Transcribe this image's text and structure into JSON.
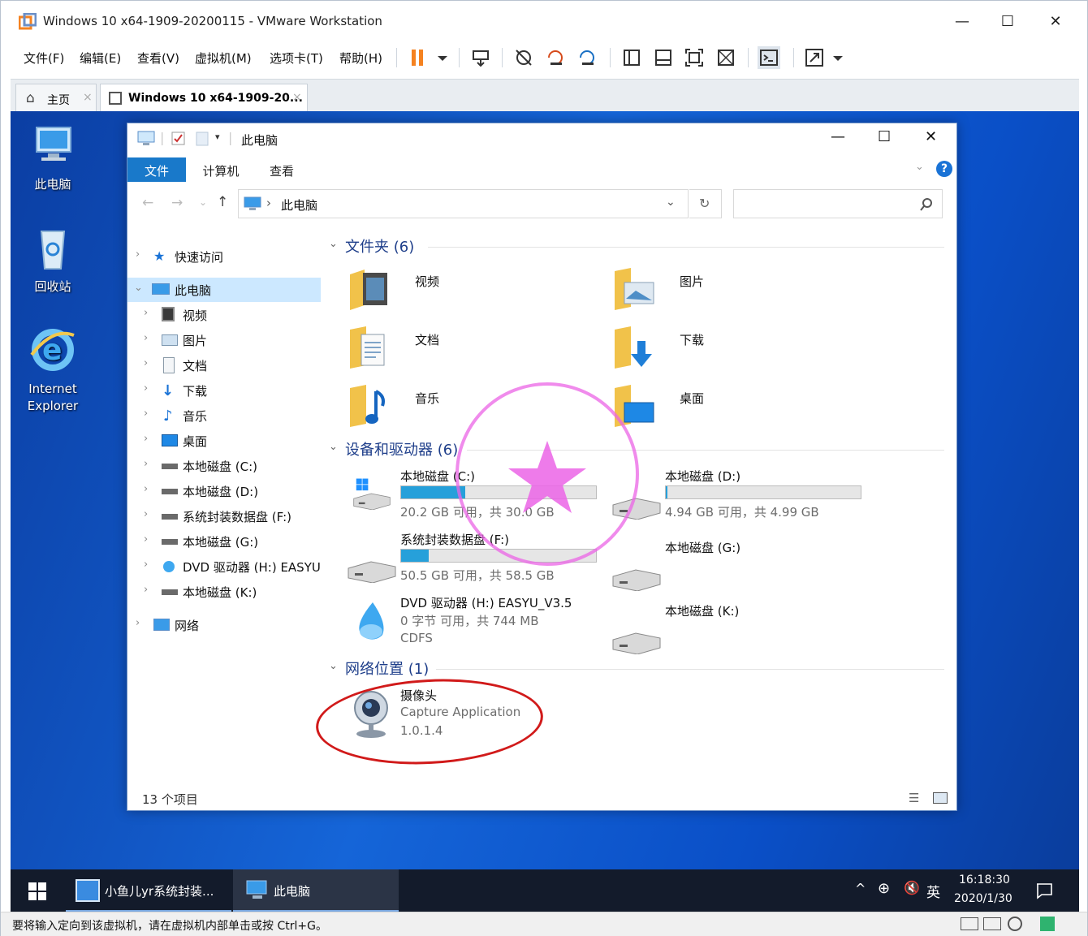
{
  "vmware": {
    "title": "Windows 10 x64-1909-20200115 - VMware Workstation",
    "menu": [
      "文件(F)",
      "编辑(E)",
      "查看(V)",
      "虚拟机(M)",
      "选项卡(T)",
      "帮助(H)"
    ],
    "tabs": [
      {
        "label": "主页",
        "close": "×"
      },
      {
        "label": "Windows 10 x64-1909-20...",
        "close": "×"
      }
    ],
    "status_message": "要将输入定向到该虚拟机，请在虚拟机内部单击或按 Ctrl+G。",
    "window_buttons": {
      "min": "—",
      "max": "☐",
      "close": "✕"
    }
  },
  "desktop": {
    "icons": [
      {
        "label": "此电脑",
        "icon": "computer-icon"
      },
      {
        "label": "回收站",
        "icon": "recycle-bin-icon"
      },
      {
        "label": "Internet Explorer",
        "icon": "internet-explorer-icon"
      }
    ]
  },
  "explorer": {
    "title": "此电脑",
    "ribbon_tabs": [
      "文件",
      "计算机",
      "查看"
    ],
    "address": "此电脑",
    "address_sep": "›",
    "search_placeholder": "",
    "nav": [
      {
        "label": "快速访问",
        "icon": "star-icon",
        "level": 0,
        "expanded": false
      },
      {
        "label": "此电脑",
        "icon": "computer-icon",
        "level": 0,
        "expanded": true,
        "selected": true
      },
      {
        "label": "视频",
        "icon": "video-icon",
        "level": 1
      },
      {
        "label": "图片",
        "icon": "picture-icon",
        "level": 1
      },
      {
        "label": "文档",
        "icon": "document-icon",
        "level": 1
      },
      {
        "label": "下载",
        "icon": "download-icon",
        "level": 1
      },
      {
        "label": "音乐",
        "icon": "music-icon",
        "level": 1
      },
      {
        "label": "桌面",
        "icon": "desktop-icon",
        "level": 1
      },
      {
        "label": "本地磁盘 (C:)",
        "icon": "drive-icon",
        "level": 1
      },
      {
        "label": "本地磁盘 (D:)",
        "icon": "drive-icon",
        "level": 1
      },
      {
        "label": "系统封装数据盘 (F:)",
        "icon": "drive-icon",
        "level": 1
      },
      {
        "label": "本地磁盘 (G:)",
        "icon": "drive-icon",
        "level": 1
      },
      {
        "label": "DVD 驱动器 (H:) EASYU",
        "icon": "dvd-icon",
        "level": 1
      },
      {
        "label": "本地磁盘 (K:)",
        "icon": "drive-icon",
        "level": 1
      },
      {
        "label": "网络",
        "icon": "network-icon",
        "level": 0
      }
    ],
    "sections": {
      "folders": "文件夹 (6)",
      "devices": "设备和驱动器 (6)",
      "network": "网络位置 (1)"
    },
    "folders": [
      "视频",
      "图片",
      "文档",
      "下载",
      "音乐",
      "桌面"
    ],
    "drives": [
      {
        "label": "本地磁盘 (C:)",
        "free": "20.2 GB 可用，共 30.0 GB",
        "used_fraction": 0.33,
        "bar": true
      },
      {
        "label": "本地磁盘 (D:)",
        "free": "4.94 GB 可用，共 4.99 GB",
        "used_fraction": 0.01,
        "bar": true
      },
      {
        "label": "系统封装数据盘 (F:)",
        "free": "50.5 GB 可用，共 58.5 GB",
        "used_fraction": 0.14,
        "bar": true
      },
      {
        "label": "本地磁盘 (G:)",
        "free": "",
        "bar": false
      },
      {
        "label": "DVD 驱动器 (H:) EASYU_V3.5",
        "free": "0 字节 可用，共 744 MB",
        "fs": "CDFS",
        "bar": false
      },
      {
        "label": "本地磁盘 (K:)",
        "free": "",
        "bar": false
      }
    ],
    "network_item": {
      "name": "摄像头",
      "line1": "Capture Application",
      "line2": "1.0.1.4"
    },
    "status": "13 个项目"
  },
  "taskbar": {
    "apps": [
      {
        "label": "小鱼儿yr系统封装..."
      },
      {
        "label": "此电脑"
      }
    ],
    "ime": "英",
    "time": "16:18:30",
    "date": "2020/1/30"
  },
  "colors": {
    "accent": "#1979ca",
    "desktop": "#0f58c9",
    "bar": "#26a0da",
    "stamp": "#eb64e6",
    "ellipse": "#d11a1a"
  }
}
